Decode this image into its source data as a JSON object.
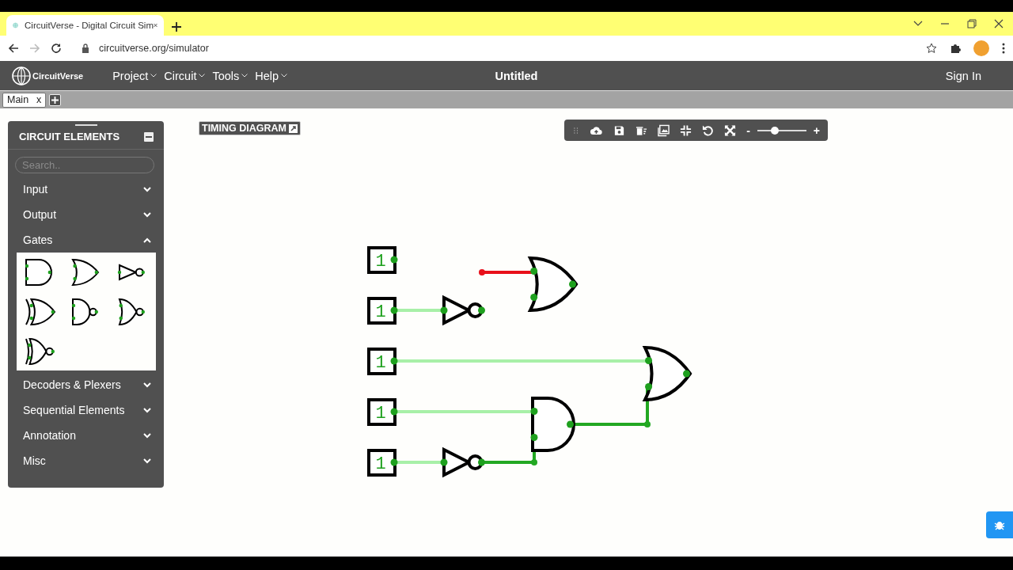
{
  "browser": {
    "tab_title": "CircuitVerse - Digital Circuit Sim",
    "url": "circuitverse.org/simulator"
  },
  "navbar": {
    "logo": "CircuitVerse",
    "menus": [
      "Project",
      "Circuit",
      "Tools",
      "Help"
    ],
    "title": "Untitled",
    "sign_in": "Sign In"
  },
  "circuit_tabs": [
    {
      "label": "Main",
      "close": "x",
      "selected": true
    }
  ],
  "timing_diagram": "TIMING DIAGRAM",
  "toolbar": {
    "zoom_out": "-",
    "zoom_in": "+",
    "zoom": {
      "level": 0.35
    }
  },
  "panel": {
    "title": "CIRCUIT ELEMENTS",
    "search": {
      "placeholder": "Search.."
    },
    "categories": [
      {
        "label": "Input",
        "expanded": false
      },
      {
        "label": "Output",
        "expanded": false
      },
      {
        "label": "Gates",
        "expanded": true,
        "items": [
          {
            "kind": "and"
          },
          {
            "kind": "or"
          },
          {
            "kind": "not"
          },
          {
            "kind": "xor"
          },
          {
            "kind": "nand"
          },
          {
            "kind": "nor"
          },
          {
            "kind": "xnor"
          }
        ]
      },
      {
        "label": "Decoders & Plexers",
        "expanded": false
      },
      {
        "label": "Sequential Elements",
        "expanded": false
      },
      {
        "label": "Annotation",
        "expanded": false
      },
      {
        "label": "Misc",
        "expanded": false
      }
    ]
  },
  "circuit": {
    "inputs": [
      {
        "value": "1"
      },
      {
        "value": "1"
      },
      {
        "value": "1"
      },
      {
        "value": "1"
      },
      {
        "value": "1"
      }
    ],
    "wires": [
      {
        "color": "#e8101a"
      },
      {
        "color": "#a8f0a8"
      },
      {
        "color": "#a8f0a8"
      },
      {
        "color": "#a8f0a8"
      },
      {
        "color": "#a8f0a8"
      },
      {
        "color": "#22a822"
      },
      {
        "color": "#22a822"
      }
    ]
  }
}
